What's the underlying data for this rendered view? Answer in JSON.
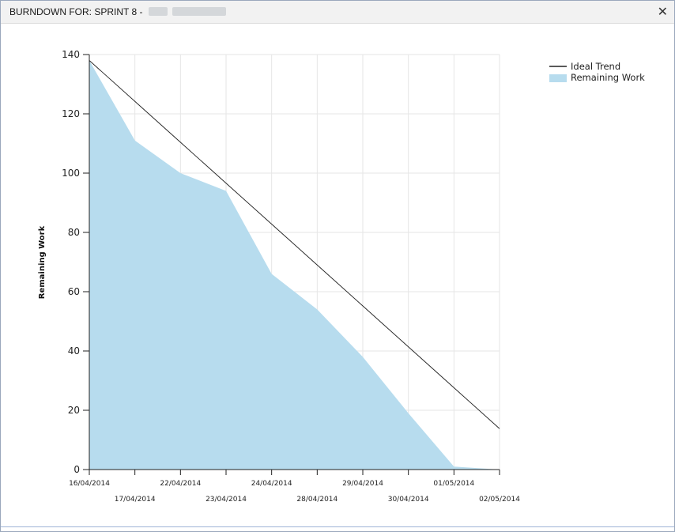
{
  "window": {
    "title": "BURNDOWN FOR: SPRINT 8 -",
    "close_icon": "close-icon"
  },
  "colors": {
    "remaining_fill": "#b7dcee",
    "ideal_line": "#222222",
    "grid": "#e6e6e6"
  },
  "chart_data": {
    "type": "area",
    "ylabel": "Remaining Work",
    "xlabel": "",
    "ylim": [
      0,
      140
    ],
    "y_ticks": [
      0,
      20,
      40,
      60,
      80,
      100,
      120,
      140
    ],
    "grid": true,
    "legend_position": "top-right",
    "categories": [
      "16/04/2014",
      "17/04/2014",
      "22/04/2014",
      "23/04/2014",
      "24/04/2014",
      "28/04/2014",
      "29/04/2014",
      "30/04/2014",
      "01/05/2014",
      "02/05/2014"
    ],
    "series": [
      {
        "name": "Remaining Work",
        "kind": "area",
        "values": [
          138,
          111,
          100,
          94,
          66,
          54,
          38,
          19,
          1,
          0
        ]
      },
      {
        "name": "Ideal Trend",
        "kind": "line",
        "values": [
          138,
          124.2,
          110.4,
          96.6,
          82.8,
          69,
          55.2,
          41.4,
          27.6,
          13.8
        ]
      }
    ]
  }
}
